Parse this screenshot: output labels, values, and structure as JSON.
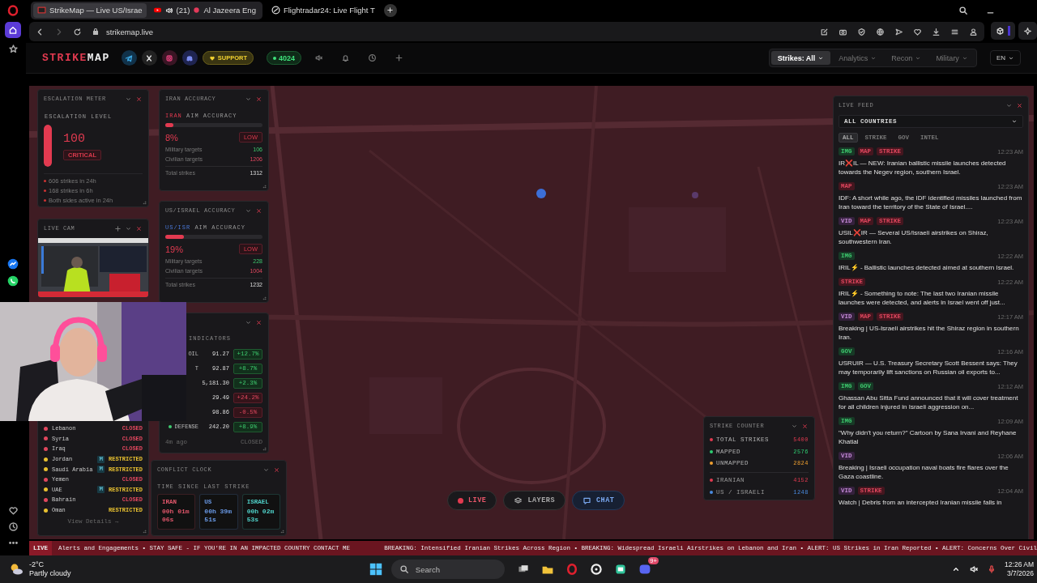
{
  "browser": {
    "tabs": [
      {
        "title": "StrikeMap — Live US/Israe",
        "kind": "site",
        "selected": true
      },
      {
        "count": "(21)",
        "title": "Al Jazeera Eng",
        "kind": "video",
        "selected": false
      },
      {
        "title": "Flightradar24: Live Flight T",
        "kind": "flight",
        "selected": false
      }
    ],
    "url": "strikemap.live"
  },
  "header": {
    "logo": [
      "STRIKE",
      "MAP"
    ],
    "socials": [
      {
        "kind": "telegram"
      },
      {
        "kind": "x"
      },
      {
        "kind": "instagram"
      },
      {
        "kind": "discord"
      }
    ],
    "support": "SUPPORT",
    "online": "4024",
    "nav": [
      {
        "label": "Strikes: All",
        "selected": true
      },
      {
        "label": "Analytics",
        "selected": false
      },
      {
        "label": "Recon",
        "selected": false
      },
      {
        "label": "Military",
        "selected": false
      }
    ],
    "language": "EN"
  },
  "escalation": {
    "title": "ESCALATION METER",
    "label": "ESCALATION LEVEL",
    "level": 1,
    "value": "100",
    "badge": "CRITICAL",
    "facts": [
      "606 strikes in 24h",
      "168 strikes in 6h",
      "Both sides active in 24h"
    ]
  },
  "accuracy": [
    {
      "title": "IRAN ACCURACY",
      "side": "IRAN",
      "label": "AIM ACCURACY",
      "kind": "iran",
      "level": 0.08,
      "percent": "8%",
      "rating": "LOW",
      "rows": [
        {
          "label": "Military targets",
          "value": "106",
          "kind": "military"
        },
        {
          "label": "Civilian targets",
          "value": "1206",
          "kind": "civilian"
        },
        {
          "label": "Total strikes",
          "value": "1312",
          "kind": "total"
        }
      ]
    },
    {
      "title": "US/ISRAEL ACCURACY",
      "side": "US/ISR",
      "label": "AIM ACCURACY",
      "kind": "allied",
      "level": 0.19,
      "percent": "19%",
      "rating": "LOW",
      "rows": [
        {
          "label": "Military targets",
          "value": "228",
          "kind": "military"
        },
        {
          "label": "Civilian targets",
          "value": "1004",
          "kind": "civilian"
        },
        {
          "label": "Total strikes",
          "value": "1232",
          "kind": "total"
        }
      ]
    }
  ],
  "live_cam": {
    "title": "LIVE CAM"
  },
  "markets": {
    "subtitle": "INDICATORS",
    "rows": [
      {
        "label": "OIL",
        "value": "91.27",
        "change": "+12.7%",
        "rising": true
      },
      {
        "label": "T",
        "value": "92.87",
        "change": "+8.7%",
        "rising": true
      },
      {
        "value": "5,181.30",
        "change": "+2.3%",
        "rising": true
      },
      {
        "value": "29.49",
        "change": "+24.2%",
        "rising": false
      },
      {
        "value": "98.86",
        "change": "-0.5%",
        "rising": false
      },
      {
        "label": "DEFENSE",
        "value": "242.20",
        "change": "+8.9%",
        "rising": true,
        "dot": true
      }
    ],
    "updated": "4m ago",
    "status": "CLOSED"
  },
  "countries": {
    "rows": [
      {
        "name": "Lebanon",
        "status": "CLOSED",
        "kind": "closed"
      },
      {
        "name": "Syria",
        "status": "CLOSED",
        "kind": "closed"
      },
      {
        "name": "Iraq",
        "status": "CLOSED",
        "kind": "closed"
      },
      {
        "name": "Jordan",
        "badge": "M",
        "status": "RESTRICTED",
        "kind": "restricted"
      },
      {
        "name": "Saudi Arabia",
        "badge": "M",
        "status": "RESTRICTED",
        "kind": "restricted"
      },
      {
        "name": "Yemen",
        "status": "CLOSED",
        "kind": "closed"
      },
      {
        "name": "UAE",
        "badge": "M",
        "status": "RESTRICTED",
        "kind": "restricted"
      },
      {
        "name": "Bahrain",
        "status": "CLOSED",
        "kind": "closed"
      },
      {
        "name": "Oman",
        "status": "RESTRICTED",
        "kind": "restricted"
      }
    ],
    "link": "View Details →"
  },
  "conflict_clock": {
    "title": "CONFLICT CLOCK",
    "label": "TIME SINCE LAST STRIKE",
    "sides": [
      {
        "name": "IRAN",
        "time": "00h 01m 06s",
        "color": "#e0566a"
      },
      {
        "name": "US",
        "time": "00h 39m 51s",
        "color": "#6a9be8"
      },
      {
        "name": "ISRAEL",
        "time": "00h 02m 53s",
        "color": "#4fd0c8"
      }
    ]
  },
  "strike_counter": {
    "title": "STRIKE COUNTER",
    "rows": [
      {
        "label": "TOTAL STRIKES",
        "value": "5400",
        "color": "#e23a50",
        "kind": "total"
      },
      {
        "label": "MAPPED",
        "value": "2576",
        "color": "#2ecc71",
        "kind": "total"
      },
      {
        "label": "UNMAPPED",
        "value": "2824",
        "color": "#f0a030",
        "kind": "total"
      },
      {
        "label": "IRANIAN",
        "value": "4152",
        "color": "#e23a50",
        "kind": "side"
      },
      {
        "label": "US / ISRAELI",
        "value": "1248",
        "color": "#4a8be0",
        "kind": "side"
      }
    ]
  },
  "live_feed": {
    "title": "LIVE FEED",
    "country": "ALL COUNTRIES",
    "filters": [
      {
        "label": "ALL",
        "selected": true
      },
      {
        "label": "STRIKE",
        "selected": false
      },
      {
        "label": "GOV",
        "selected": false
      },
      {
        "label": "INTEL",
        "selected": false
      }
    ],
    "items": [
      {
        "tags": [
          {
            "label": "IMG",
            "kind": "img"
          },
          {
            "label": "MAP",
            "kind": "map"
          },
          {
            "label": "STRIKE",
            "kind": "strike"
          }
        ],
        "time": "12:23 AM",
        "text": "IR❌IL — NEW: Iranian ballistic missile launches detected towards the Negev region, southern Israel."
      },
      {
        "tags": [
          {
            "label": "MAP",
            "kind": "map"
          }
        ],
        "time": "12:23 AM",
        "text": "IDF: A short while ago, the IDF identified missiles launched from Iran toward the territory of the State of Israel...."
      },
      {
        "tags": [
          {
            "label": "VID",
            "kind": "vid"
          },
          {
            "label": "MAP",
            "kind": "map"
          },
          {
            "label": "STRIKE",
            "kind": "strike"
          }
        ],
        "time": "12:23 AM",
        "text": "USIL❌IR — Several US/Israeli airstrikes on Shiraz, southwestern Iran."
      },
      {
        "tags": [
          {
            "label": "IMG",
            "kind": "img"
          }
        ],
        "time": "12:22 AM",
        "text": "IRIL⚡ - Ballistic launches detected aimed at southern Israel."
      },
      {
        "tags": [
          {
            "label": "STRIKE",
            "kind": "strike"
          }
        ],
        "time": "12:22 AM",
        "text": "IRIL⚡ - Something to note: The last two Iranian missile launches were detected, and alerts in Israel went off just..."
      },
      {
        "tags": [
          {
            "label": "VID",
            "kind": "vid"
          },
          {
            "label": "MAP",
            "kind": "map"
          },
          {
            "label": "STRIKE",
            "kind": "strike"
          }
        ],
        "time": "12:17 AM",
        "text": "Breaking | US-Israeli airstrikes hit the Shiraz region in southern Iran."
      },
      {
        "tags": [
          {
            "label": "GOV",
            "kind": "gov"
          }
        ],
        "time": "12:16 AM",
        "text": "USRUIR — U.S. Treasury Secretary Scott Bessent says: They may temporarily lift sanctions on Russian oil exports to..."
      },
      {
        "tags": [
          {
            "label": "IMG",
            "kind": "img"
          },
          {
            "label": "GOV",
            "kind": "gov"
          }
        ],
        "time": "12:12 AM",
        "text": "Ghassan Abu Sitta Fund announced that it will cover treatment for all children injured in Israeli aggression on..."
      },
      {
        "tags": [
          {
            "label": "IMG",
            "kind": "img"
          }
        ],
        "time": "12:09 AM",
        "text": "\"Why didn't you return?\" Cartoon by Sana Irvani and Reyhane Khatial"
      },
      {
        "tags": [
          {
            "label": "VID",
            "kind": "vid"
          }
        ],
        "time": "12:06 AM",
        "text": "Breaking | Israeli occupation naval boats fire flares over the Gaza coastline."
      },
      {
        "tags": [
          {
            "label": "VID",
            "kind": "vid"
          },
          {
            "label": "STRIKE",
            "kind": "strike"
          }
        ],
        "time": "12:04 AM",
        "text": "Watch | Debris from an intercepted Iranian missile falls in"
      }
    ]
  },
  "map_controls": [
    {
      "label": "LIVE",
      "kind": "live"
    },
    {
      "label": "LAYERS",
      "kind": "layers"
    },
    {
      "label": "CHAT",
      "kind": "chat"
    }
  ],
  "ticker": {
    "badge": "LIVE",
    "text": "Alerts and Engagements • STAY SAFE - IF YOU'RE IN AN IMPACTED COUNTRY CONTACT ME",
    "breaking": "BREAKING: Intensified Iranian Strikes Across Region • BREAKING: Widespread Israeli Airstrikes on Lebanon and Iran • ALERT: US Strikes in Iran Reported • ALERT: Concerns Over Civil"
  },
  "taskbar": {
    "temperature": "-2°C",
    "weather": "Partly cloudy",
    "search": "Search",
    "badge": "9+",
    "time": "12:26 AM",
    "date": "3/7/2026"
  }
}
